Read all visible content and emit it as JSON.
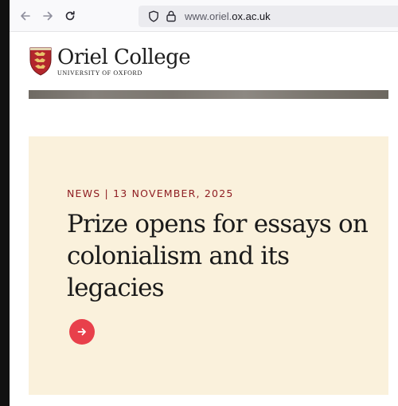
{
  "browser": {
    "url_prefix": "www.oriel.",
    "url_domain": "ox.ac.uk",
    "icons": [
      "back-arrow-icon",
      "forward-arrow-icon",
      "reload-icon",
      "shield-icon",
      "lock-icon"
    ]
  },
  "header": {
    "college_name": "Oriel College",
    "university": "UNIVERSITY OF OXFORD"
  },
  "article": {
    "meta": "NEWS | 13 NOVEMBER, 2025",
    "title": "Prize opens for essays on colonialism and its legacies"
  },
  "colors": {
    "card_background": "#faf1dc",
    "meta_text": "#8f1e23",
    "arrow_button": "#e8404b",
    "crest_red": "#b3262c"
  }
}
